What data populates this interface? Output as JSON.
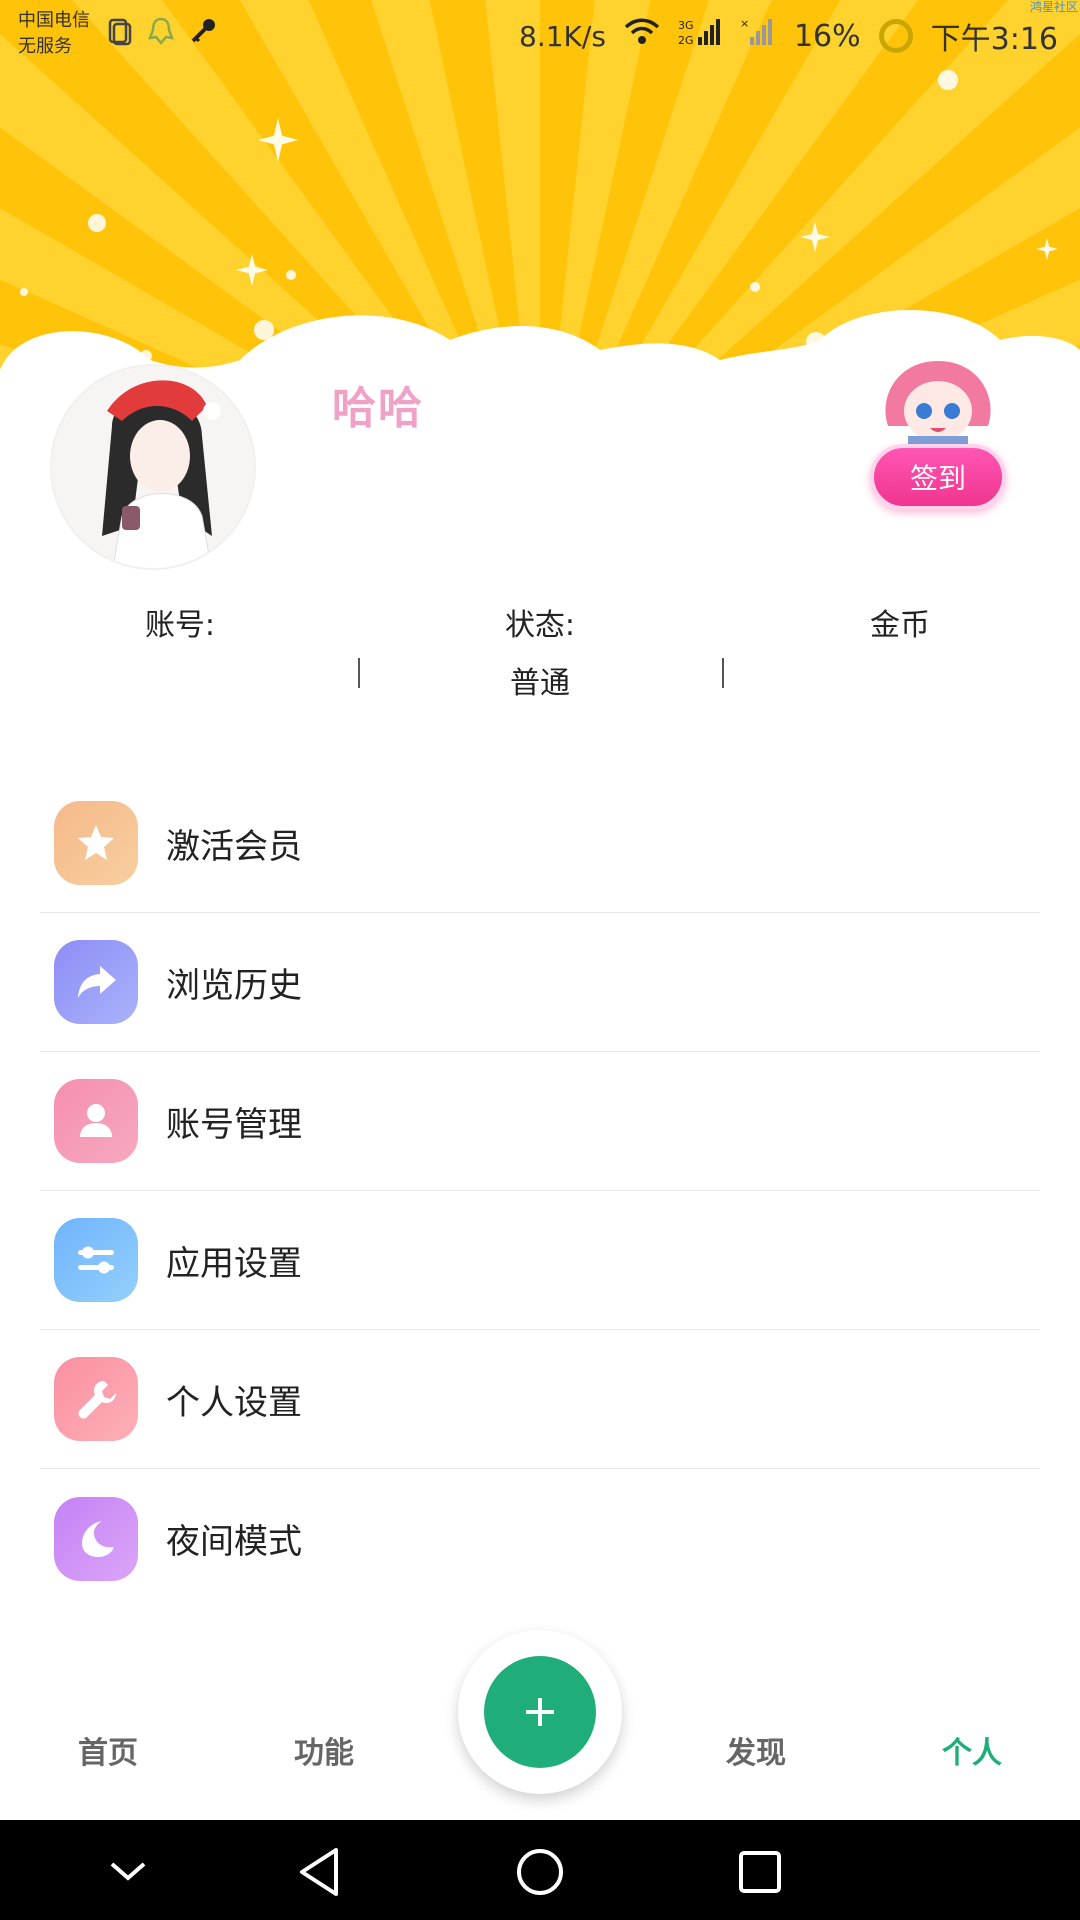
{
  "status_bar": {
    "carrier_line1": "中国电信",
    "carrier_line2": "无服务",
    "net_speed": "8.1K/s",
    "battery": "16%",
    "time": "下午3:16",
    "watermark": "鸿星社区"
  },
  "profile": {
    "nickname": "哈哈",
    "checkin_label": "签到"
  },
  "stats": {
    "account_label": "账号:",
    "account_value": "",
    "status_label": "状态:",
    "status_value": "普通",
    "coins_label": "金币",
    "coins_value": ""
  },
  "menu": {
    "items": [
      {
        "label": "激活会员",
        "icon": "star-icon",
        "color_from": "#f6b98a",
        "color_to": "#f7cfa0"
      },
      {
        "label": "浏览历史",
        "icon": "share-arrow-icon",
        "color_from": "#8e8cf5",
        "color_to": "#a9b3fb"
      },
      {
        "label": "账号管理",
        "icon": "person-icon",
        "color_from": "#f58fae",
        "color_to": "#f7a9c0"
      },
      {
        "label": "应用设置",
        "icon": "sliders-icon",
        "color_from": "#6fb4fb",
        "color_to": "#94d0fd"
      },
      {
        "label": "个人设置",
        "icon": "wrench-icon",
        "color_from": "#fb8fa0",
        "color_to": "#fdb0b9"
      },
      {
        "label": "夜间模式",
        "icon": "moon-icon",
        "color_from": "#c582f5",
        "color_to": "#dba5f8"
      }
    ]
  },
  "tabbar": {
    "tabs": [
      {
        "label": "首页"
      },
      {
        "label": "功能"
      },
      {
        "label": "发现"
      },
      {
        "label": "个人"
      }
    ],
    "active_tab": "个人",
    "accent": "#1fae7a"
  },
  "colors": {
    "banner": "#ffc40a",
    "checkin": "#f0358f"
  }
}
